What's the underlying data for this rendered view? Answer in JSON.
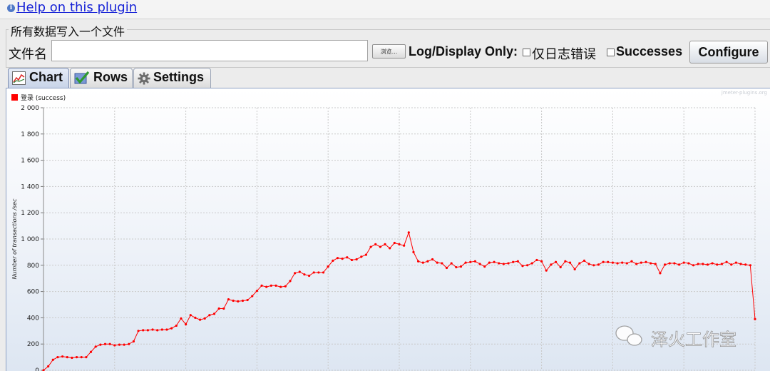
{
  "header": {
    "help_link": "Help on this plugin"
  },
  "file_group": {
    "legend": "所有数据写入一个文件",
    "filename_label": "文件名",
    "filename_value": "",
    "browse_label": "浏览...",
    "log_display_label": "Log/Display Only:",
    "errors_only_label": "仅日志错误",
    "successes_label": "Successes",
    "configure_label": "Configure"
  },
  "tabs": [
    {
      "label": "Chart",
      "icon": "chart-icon",
      "active": true
    },
    {
      "label": "Rows",
      "icon": "rows-checkmark-icon",
      "active": false
    },
    {
      "label": "Settings",
      "icon": "gear-icon",
      "active": false
    }
  ],
  "chart_data": {
    "type": "line",
    "watermark": "jmeter-plugins.org",
    "ylabel": "Number of transactions /sec",
    "ylim": [
      0,
      2000
    ],
    "yticks": [
      "0",
      "200",
      "400",
      "600",
      "800",
      "1 000",
      "1 200",
      "1 400",
      "1 600",
      "1 800",
      "2 000"
    ],
    "grid": true,
    "legend_position": "top-left",
    "series": [
      {
        "name": "登录 (success)",
        "color": "#ff0000",
        "values": [
          0,
          30,
          80,
          100,
          105,
          100,
          95,
          100,
          100,
          100,
          140,
          180,
          195,
          200,
          200,
          190,
          195,
          195,
          200,
          220,
          300,
          305,
          305,
          310,
          305,
          310,
          310,
          320,
          340,
          395,
          350,
          420,
          400,
          385,
          395,
          420,
          430,
          470,
          470,
          540,
          530,
          525,
          530,
          535,
          565,
          605,
          645,
          635,
          645,
          645,
          635,
          640,
          680,
          740,
          750,
          730,
          720,
          745,
          745,
          745,
          790,
          835,
          855,
          850,
          860,
          840,
          845,
          865,
          880,
          940,
          960,
          940,
          960,
          930,
          970,
          960,
          950,
          1050,
          900,
          830,
          820,
          830,
          845,
          820,
          815,
          780,
          815,
          785,
          790,
          820,
          825,
          830,
          810,
          790,
          820,
          825,
          815,
          810,
          815,
          825,
          830,
          795,
          800,
          815,
          840,
          830,
          760,
          805,
          825,
          785,
          830,
          820,
          770,
          815,
          835,
          810,
          800,
          805,
          825,
          825,
          820,
          815,
          820,
          815,
          830,
          810,
          820,
          825,
          815,
          810,
          740,
          805,
          815,
          815,
          805,
          820,
          815,
          800,
          810,
          810,
          805,
          815,
          805,
          810,
          825,
          805,
          820,
          810,
          805,
          800,
          390
        ]
      }
    ]
  },
  "watermark_brand": "泽火工作室"
}
